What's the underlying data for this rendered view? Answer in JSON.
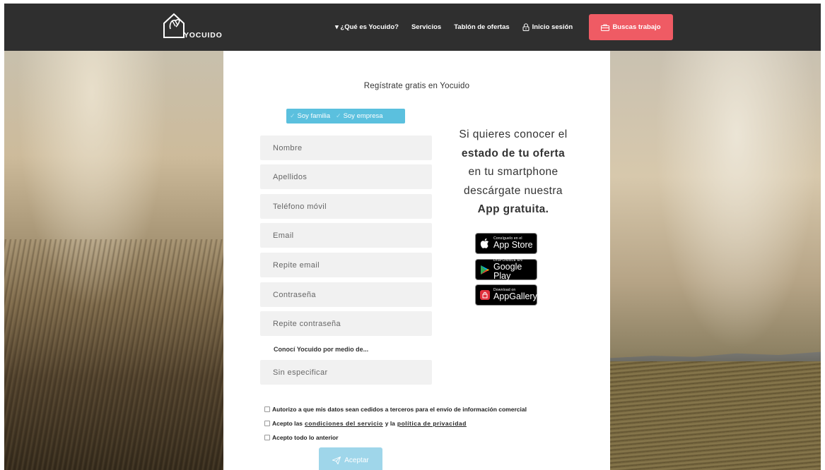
{
  "nav": {
    "logo_text": "YOCUIDO",
    "links": [
      {
        "label": "▾ ¿Qué es Yocuido?"
      },
      {
        "label": "Servicios"
      },
      {
        "label": "Tablón de ofertas"
      },
      {
        "label": "Inicio sesión"
      }
    ],
    "cta_label": "Buscas trabajo"
  },
  "form": {
    "title": "Regístrate gratis en Yocuido",
    "toggle": {
      "family": "Soy familia",
      "company": "Soy empresa"
    },
    "fields": {
      "nombre": "Nombre",
      "apellidos": "Apellidos",
      "telefono": "Teléfono móvil",
      "email": "Email",
      "repite_email": "Repite email",
      "contrasena": "Contraseña",
      "repite_contrasena": "Repite contraseña"
    },
    "how_label": "Conocí Yocuido por medio de...",
    "select_value": "Sin especificar",
    "checks": {
      "c1": "Autorizo a que mis datos sean cedidos a terceros para el envío de información comercial",
      "c2_pre": "Acepto las ",
      "c2_link1": "condiciones del servicio",
      "c2_mid": " y la ",
      "c2_link2": "política de privacidad",
      "c3": "Acepto todo lo anterior"
    },
    "submit": "Aceptar"
  },
  "promo": {
    "line1": "Si quieres conocer el",
    "line2": "estado de tu oferta",
    "line3": "en tu smartphone",
    "line4": "descárgate nuestra",
    "line5": "App gratuita.",
    "badges": {
      "appstore_small": "Consíguelo en el",
      "appstore_big": "App Store",
      "google_small": "DISPONIBLE EN",
      "google_big": "Google Play",
      "huawei_small": "Download on",
      "huawei_big": "AppGallery"
    }
  },
  "colors": {
    "navbar": "#2f2f2f",
    "cta": "#ef5b64",
    "toggle": "#5bc0de",
    "submit": "#9fd6ea"
  }
}
